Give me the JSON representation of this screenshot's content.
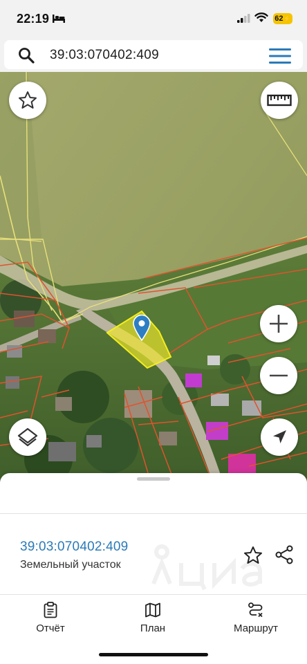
{
  "status_bar": {
    "time": "22:19",
    "battery_level": "62",
    "icons": [
      "bed-icon",
      "signal-icon",
      "wifi-icon",
      "battery-icon"
    ]
  },
  "search": {
    "value": "39:03:070402:409",
    "icons": [
      "search-icon",
      "menu-icon"
    ]
  },
  "map": {
    "controls": [
      "star-icon",
      "ruler-icon",
      "plus-icon",
      "minus-icon",
      "layers-icon",
      "navigation-arrow-icon"
    ],
    "marker": "location-pin-icon",
    "colors": {
      "field": "#8f9a5c",
      "parcel_border": "#e0532e",
      "selected_parcel": "#f1ea2a",
      "zone_border": "#e8e07a",
      "pin": "#2d7ec3"
    }
  },
  "sheet": {
    "parcel_number": "39:03:070402:409",
    "parcel_type": "Земельный участок",
    "colors": {
      "link": "#2a7ab8"
    }
  },
  "tabs": [
    {
      "label": "Отчёт",
      "icon": "clipboard-icon"
    },
    {
      "label": "План",
      "icon": "map-icon"
    },
    {
      "label": "Маршрут",
      "icon": "route-icon"
    }
  ]
}
